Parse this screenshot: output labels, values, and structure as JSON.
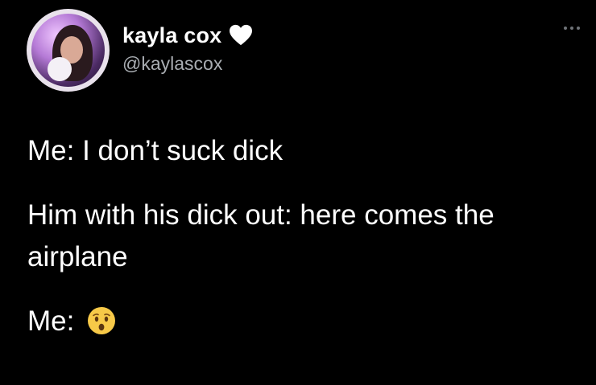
{
  "author": {
    "display_name": "kayla cox",
    "handle": "@kaylascox",
    "name_badge_icon": "white-heart-icon",
    "avatar_icon": "profile-photo"
  },
  "menu": {
    "icon": "more-options-icon"
  },
  "tweet": {
    "line1": "Me: I don’t suck dick",
    "line2": "Him with his dick out: here comes the airplane",
    "line3_prefix": "Me:",
    "line3_emoji_icon": "hushed-face-emoji-icon"
  },
  "colors": {
    "background": "#000000",
    "text": "#ffffff",
    "handle": "#a9adb2",
    "emoji": "#f7c948"
  }
}
